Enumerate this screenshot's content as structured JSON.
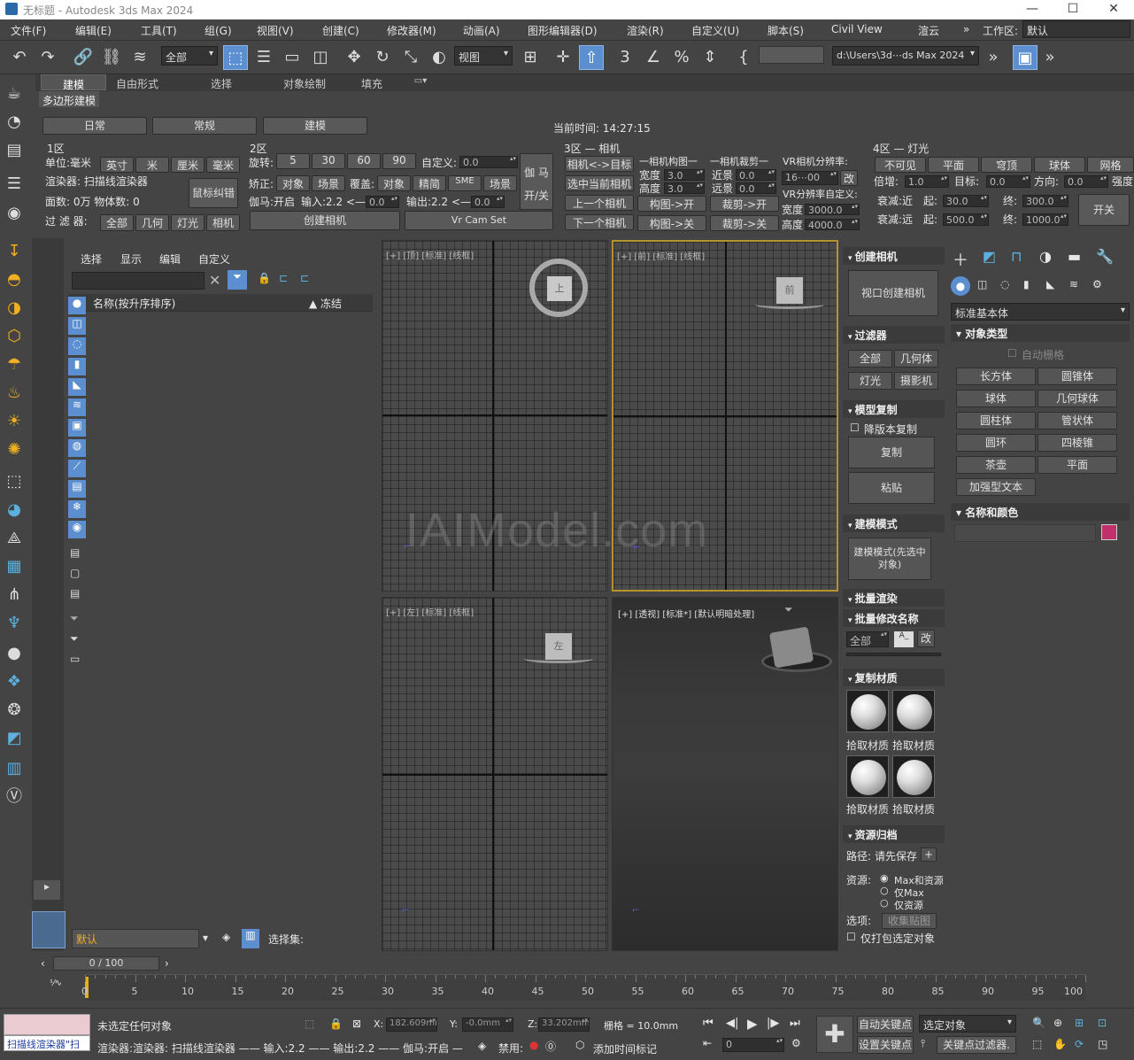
{
  "window": {
    "title": "无标题 - Autodesk 3ds Max 2024",
    "min": "—",
    "max": "☐",
    "close": "✕"
  },
  "menu": [
    "文件(F)",
    "编辑(E)",
    "工具(T)",
    "组(G)",
    "视图(V)",
    "创建(C)",
    "修改器(M)",
    "动画(A)",
    "图形编辑器(D)",
    "渲染(R)",
    "自定义(U)",
    "脚本(S)",
    "Civil View",
    "渲云",
    "»",
    "工作区:",
    "默认"
  ],
  "toolbar": {
    "selection_filter": "全部",
    "ref_coord": "视图",
    "path": "d:\\Users\\3d⋯ds Max 2024"
  },
  "ribbon_tabs": [
    "建模",
    "自由形式",
    "选择",
    "对象绘制",
    "填充"
  ],
  "ribbon_sub": "多边形建模",
  "top_buttons": [
    "日常",
    "常规",
    "建模"
  ],
  "current_time": "当前时间: 14:27:15",
  "zone1": {
    "title": "1区",
    "unit_label": "单位:毫米",
    "units": [
      "英寸",
      "米",
      "厘米",
      "毫米"
    ],
    "renderer": "渲染器: 扫描线渲染器",
    "faces": "面数: 0万 物体数: 0",
    "filter_label": "过 滤 器:",
    "filters": [
      "全部",
      "几何",
      "灯光",
      "相机"
    ],
    "mouse_btn": "鼠标纠错"
  },
  "zone2": {
    "title": "2区",
    "rotate_label": "旋转:",
    "rotates": [
      "5",
      "30",
      "60",
      "90"
    ],
    "custom_label": "自定义:",
    "custom_val": "0.0",
    "correct_label": "矫正:",
    "correct": [
      "对象",
      "场景"
    ],
    "cover_label": "覆盖:",
    "cover": [
      "对象",
      "精简",
      "SME",
      "场景"
    ],
    "gamma_on": "伽马:开启",
    "input": "输入:2.2 <—",
    "input_val": "0.0",
    "output": "输出:2.2 <—",
    "output_val": "0.0",
    "gamma_btn": "伽 马",
    "onoff": "开/关",
    "create_cam": "创建相机",
    "vr_cam": "Vr Cam Set"
  },
  "zone3": {
    "title": "3区 — 相机",
    "cam_target": "相机<->目标",
    "select_cam": "选中当前相机",
    "prev_cam": "上一个相机",
    "next_cam": "下一个相机",
    "comp_title": "一相机构图一",
    "width": "宽度",
    "height": "高度",
    "w_val": "3.0",
    "h_val": "3.0",
    "comp_on": "构图->开",
    "comp_off": "构图->关",
    "clip_title": "一相机裁剪一",
    "near": "近景",
    "far": "远景",
    "n_val": "0.0",
    "f_val": "0.0",
    "clip_on": "裁剪->开",
    "clip_off": "裁剪->关",
    "vr_res": "VR相机分辨率:",
    "res_val": "16⋯00",
    "change": "改",
    "vr_custom": "VR分辨率自定义:",
    "cw": "宽度",
    "ch": "高度",
    "cw_val": "3000.0",
    "ch_val": "4000.0"
  },
  "zone4": {
    "title": "4区 — 灯光",
    "light_types": [
      "不可见",
      "平面",
      "穹顶",
      "球体",
      "网格"
    ],
    "mult": "倍增:",
    "mult_val": "1.0",
    "target": "目标:",
    "target_val": "0.0",
    "dir": "方向:",
    "dir_val": "0.0",
    "strength": "强度",
    "near_label": "衰减:近",
    "far_label": "衰减:远",
    "start": "起:",
    "end": "终:",
    "ns": "30.0",
    "ne": "300.0",
    "fs": "500.0",
    "fe": "1000.0",
    "onoff": "开关"
  },
  "scene_explorer": {
    "tabs": [
      "选择",
      "显示",
      "编辑",
      "自定义"
    ],
    "col_name": "名称(按升序排序)",
    "col_frozen": "▲ 冻结",
    "layer": "默认",
    "selset": "选择集:"
  },
  "viewports": {
    "top": "[+] [顶] [标准] [线框]",
    "front": "[+] [前] [标准] [线框]",
    "left": "[+] [左] [标准] [线框]",
    "persp": "[+] [透视] [标准*] [默认明暗处理]",
    "cube_top": "上",
    "cube_front": "前",
    "cube_left": "左",
    "watermark": "IAIModel.com"
  },
  "cmd": {
    "create_cam_title": "创建相机",
    "vp_create": "视口创建相机",
    "filter_title": "过滤器",
    "filter_btns": [
      "全部",
      "几何体",
      "灯光",
      "摄影机"
    ],
    "copy_title": "模型复制",
    "downgrade": "降版本复制",
    "copy": "复制",
    "paste": "粘贴",
    "mode_title": "建模模式",
    "mode_btn": "建模模式(先选中对象)",
    "batch_render": "批量渲染",
    "batch_rename": "批量修改名称",
    "all": "全部",
    "rename_btn": "改",
    "copy_mat": "复制材质",
    "pick_mat": "拾取材质",
    "asset_title": "资源归档",
    "path_label": "路径:",
    "path_val": "请先保存",
    "res_label": "资源:",
    "res_opts": [
      "Max和资源",
      "仅Max",
      "仅资源"
    ],
    "opt_label": "选项:",
    "collect": "收集贴图",
    "pack": "仅打包选定对象"
  },
  "create_panel": {
    "category": "标准基本体",
    "obj_type": "对象类型",
    "auto_grid": "自动栅格",
    "objects": [
      "长方体",
      "圆锥体",
      "球体",
      "几何球体",
      "圆柱体",
      "管状体",
      "圆环",
      "四棱锥",
      "茶壶",
      "平面",
      "加强型文本"
    ],
    "name_color": "名称和颜色",
    "color": "#c0306a"
  },
  "timeline": {
    "frame": "0 / 100",
    "ticks": [
      "0",
      "5",
      "10",
      "15",
      "20",
      "25",
      "30",
      "35",
      "40",
      "45",
      "50",
      "55",
      "60",
      "65",
      "70",
      "75",
      "80",
      "85",
      "90",
      "95",
      "100"
    ]
  },
  "status": {
    "script_val": "扫描线渲染器\"扫",
    "msg": "未选定任何对象",
    "x": "X:",
    "xv": "182.609mm",
    "y": "Y:",
    "yv": "-0.0mm",
    "z": "Z:",
    "zv": "33.202mm",
    "grid": "栅格 = 10.0mm",
    "info": "渲染器:渲染器: 扫描线渲染器 —— 输入:2.2 —— 输出:2.2 —— 伽马:开启 —",
    "disabled": "禁用:",
    "add_time": "添加时间标记",
    "autokey": "自动关键点",
    "setkey": "设置关键点",
    "selobj": "选定对象",
    "keyfilter": "关键点过滤器.",
    "frame_val": "0"
  }
}
